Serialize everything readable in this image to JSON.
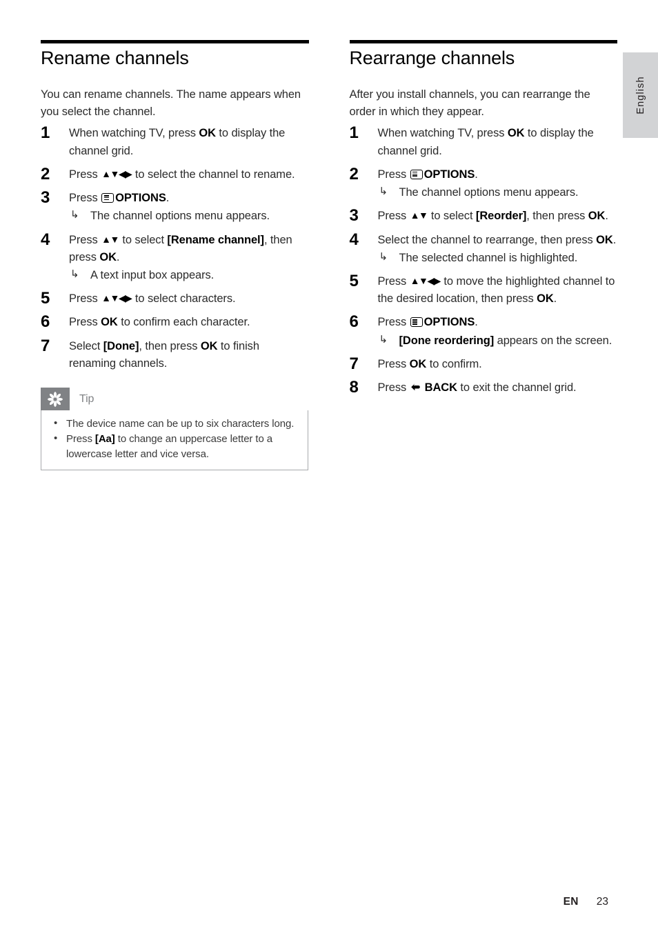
{
  "side_tab": {
    "language": "English"
  },
  "footer": {
    "language_code": "EN",
    "page_number": "23"
  },
  "columns": [
    {
      "title": "Rename channels",
      "intro": "You can rename channels. The name appears when you select the channel.",
      "steps": [
        {
          "number": "1",
          "text_before": "When watching TV, press ",
          "bold": "OK",
          "text_after": " to display the channel grid.",
          "icon": "none",
          "sub": null
        },
        {
          "number": "2",
          "text_before": "Press ",
          "arrows": "▲▼◀▶",
          "text_after": " to select the channel to rename.",
          "icon": "nav-arrows",
          "sub": null
        },
        {
          "number": "3",
          "text_before": "Press ",
          "bold": "OPTIONS",
          "text_after": ".",
          "icon": "options-icon",
          "sub": {
            "arrow": "↳",
            "text": "The channel options menu appears."
          }
        },
        {
          "number": "4",
          "text_before": "Press ",
          "arrows": "▲▼",
          "text_mid": " to select ",
          "bold": "[Rename channel]",
          "text_after2": ", then press ",
          "bold2": "OK",
          "text_end": ".",
          "icon": "nav-arrows",
          "sub": {
            "arrow": "↳",
            "text": "A text input box appears."
          }
        },
        {
          "number": "5",
          "text_before": "Press ",
          "arrows": "▲▼◀▶",
          "text_after": " to select characters.",
          "icon": "nav-arrows",
          "sub": null
        },
        {
          "number": "6",
          "text_before": "Press ",
          "bold": "OK",
          "text_after": " to confirm each character.",
          "icon": "none",
          "sub": null
        },
        {
          "number": "7",
          "text_before": "Select ",
          "bold": "[Done]",
          "text_after2": ", then press ",
          "bold2": "OK",
          "text_end": " to finish renaming channels.",
          "icon": "none",
          "sub": null
        }
      ],
      "tip": {
        "icon": "asterisk-icon",
        "label": "Tip",
        "items": [
          {
            "bullet": "•",
            "text": "The device name can be up to six characters long."
          },
          {
            "bullet": "•",
            "text_before": "Press ",
            "bold": "[Aa]",
            "text_after": " to change an uppercase letter to a lowercase letter and vice versa."
          }
        ]
      }
    },
    {
      "title": "Rearrange channels",
      "intro": "After you install channels, you can rearrange the order in which they appear.",
      "steps": [
        {
          "number": "1",
          "text_before": "When watching TV, press ",
          "bold": "OK",
          "text_after": " to display the channel grid.",
          "icon": "none",
          "sub": null
        },
        {
          "number": "2",
          "text_before": "Press ",
          "bold": "OPTIONS",
          "text_after": ".",
          "icon": "options-icon",
          "sub": {
            "arrow": "↳",
            "text": "The channel options menu appears."
          }
        },
        {
          "number": "3",
          "text_before": "Press ",
          "arrows": "▲▼",
          "text_mid": " to select ",
          "bold": "[Reorder]",
          "text_after2": ", then press ",
          "bold2": "OK",
          "text_end": ".",
          "icon": "nav-arrows",
          "sub": null
        },
        {
          "number": "4",
          "text_before": "Select the channel to rearrange, then press ",
          "bold": "OK",
          "text_after": ".",
          "icon": "none",
          "sub": {
            "arrow": "↳",
            "text": "The selected channel is highlighted."
          }
        },
        {
          "number": "5",
          "text_before": "Press ",
          "arrows": "▲▼◀▶",
          "text_mid": " to move the highlighted channel to the desired location, then press ",
          "bold": "OK",
          "text_end": ".",
          "icon": "nav-arrows",
          "sub": null
        },
        {
          "number": "6",
          "text_before": "Press ",
          "bold": "OPTIONS",
          "text_after": ".",
          "icon": "options-icon",
          "sub": {
            "arrow": "↳",
            "bold": "[Done reordering]",
            "text": " appears on the screen."
          }
        },
        {
          "number": "7",
          "text_before": "Press ",
          "bold": "OK",
          "text_after": " to confirm.",
          "icon": "none",
          "sub": null
        },
        {
          "number": "8",
          "text_before": "Press ",
          "bold": "BACK",
          "text_after": " to exit the channel grid.",
          "icon": "back-icon",
          "sub": null
        }
      ],
      "tip": null
    }
  ],
  "colors": {
    "rule": "#000000",
    "tip_gray": "#808285",
    "tip_border": "#a7a9ac",
    "side_tab_gray": "#d2d3d5",
    "body_text": "#2b2b2b"
  }
}
